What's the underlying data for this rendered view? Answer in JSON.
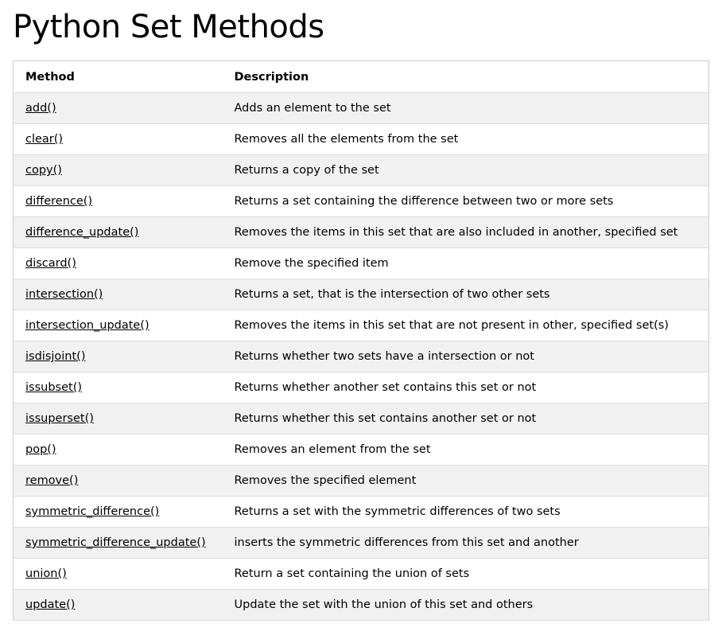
{
  "page": {
    "title": "Python Set Methods"
  },
  "table": {
    "headers": {
      "method": "Method",
      "description": "Description"
    },
    "rows": [
      {
        "method": "add()",
        "description": "Adds an element to the set"
      },
      {
        "method": "clear()",
        "description": "Removes all the elements from the set"
      },
      {
        "method": "copy()",
        "description": "Returns a copy of the set"
      },
      {
        "method": "difference()",
        "description": "Returns a set containing the difference between two or more sets"
      },
      {
        "method": "difference_update()",
        "description": "Removes the items in this set that are also included in another, specified set"
      },
      {
        "method": "discard()",
        "description": "Remove the specified item"
      },
      {
        "method": "intersection()",
        "description": "Returns a set, that is the intersection of two other sets"
      },
      {
        "method": "intersection_update()",
        "description": "Removes the items in this set that are not present in other, specified set(s)"
      },
      {
        "method": "isdisjoint()",
        "description": "Returns whether two sets have a intersection or not"
      },
      {
        "method": "issubset()",
        "description": "Returns whether another set contains this set or not"
      },
      {
        "method": "issuperset()",
        "description": "Returns whether this set contains another set or not"
      },
      {
        "method": "pop()",
        "description": "Removes an element from the set"
      },
      {
        "method": "remove()",
        "description": "Removes the specified element"
      },
      {
        "method": "symmetric_difference()",
        "description": "Returns a set with the symmetric differences of two sets"
      },
      {
        "method": "symmetric_difference_update()",
        "description": "inserts the symmetric differences from this set and another"
      },
      {
        "method": "union()",
        "description": "Return a set containing the union of sets"
      },
      {
        "method": "update()",
        "description": "Update the set with the union of this set and others"
      }
    ]
  },
  "colors": {
    "row_stripe": "#f1f1f1",
    "row_plain": "#ffffff",
    "border": "#cccccc",
    "text": "#000000"
  }
}
